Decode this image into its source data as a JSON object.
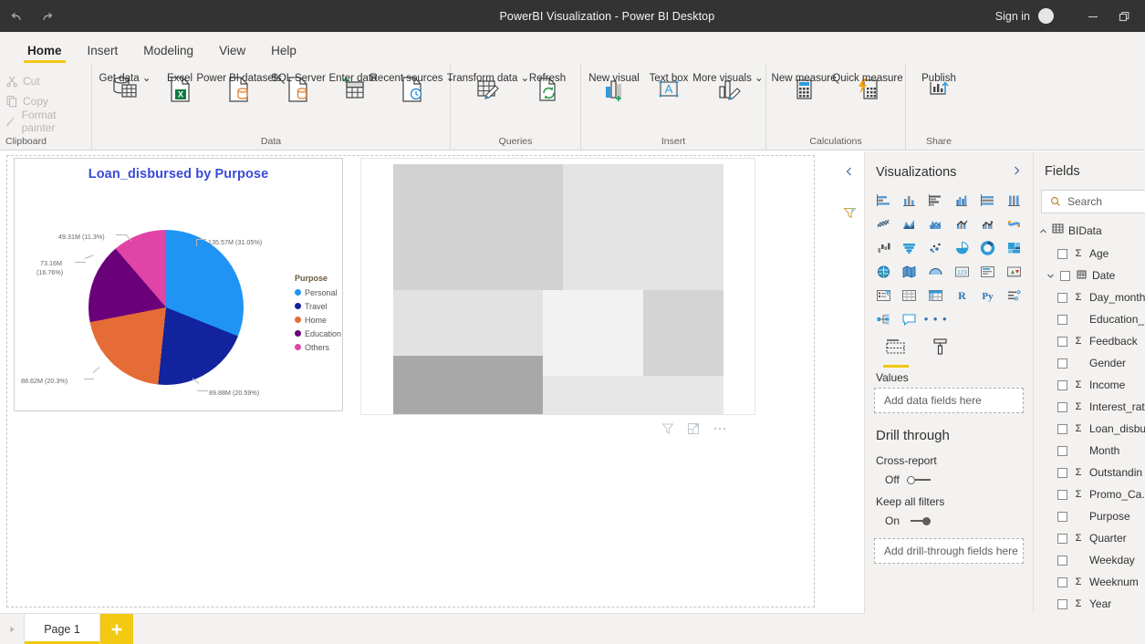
{
  "titlebar": {
    "undo_icon": "undo-icon",
    "redo_icon": "redo-icon",
    "title": "PowerBI Visualization - Power BI Desktop",
    "signin_label": "Sign in",
    "avatar_icon": "account-avatar",
    "minimize_label": "minimize-icon",
    "restore_label": "restore-icon"
  },
  "ribbon": {
    "tabs": [
      {
        "label": "Home",
        "active": true
      },
      {
        "label": "Insert",
        "active": false
      },
      {
        "label": "Modeling",
        "active": false
      },
      {
        "label": "View",
        "active": false
      },
      {
        "label": "Help",
        "active": false
      }
    ],
    "groups": [
      {
        "name": "Clipboard",
        "label": "Clipboard",
        "items": [
          {
            "label": "Cut",
            "icon": "scissors-icon"
          },
          {
            "label": "Copy",
            "icon": "copy-icon"
          },
          {
            "label": "Format painter",
            "icon": "format-painter-icon"
          }
        ]
      },
      {
        "name": "Data",
        "label": "Data",
        "items": [
          {
            "label": "Get data",
            "icon": "get-data-icon",
            "caret": true
          },
          {
            "label": "Excel",
            "icon": "excel-icon",
            "caret": false
          },
          {
            "label": "Power BI datasets",
            "icon": "powerbi-datasets-icon",
            "caret": false
          },
          {
            "label": "SQL Server",
            "icon": "sql-server-icon",
            "caret": false
          },
          {
            "label": "Enter data",
            "icon": "enter-data-icon",
            "caret": false
          },
          {
            "label": "Recent sources",
            "icon": "recent-sources-icon",
            "caret": true
          }
        ]
      },
      {
        "name": "Queries",
        "label": "Queries",
        "items": [
          {
            "label": "Transform data",
            "icon": "transform-data-icon",
            "caret": true
          },
          {
            "label": "Refresh",
            "icon": "refresh-icon",
            "caret": false
          }
        ]
      },
      {
        "name": "Insert",
        "label": "Insert",
        "items": [
          {
            "label": "New visual",
            "icon": "new-visual-icon",
            "caret": false
          },
          {
            "label": "Text box",
            "icon": "text-box-icon",
            "caret": false
          },
          {
            "label": "More visuals",
            "icon": "more-visuals-icon",
            "caret": true
          }
        ]
      },
      {
        "name": "Calculations",
        "label": "Calculations",
        "items": [
          {
            "label": "New measure",
            "icon": "new-measure-icon",
            "caret": false
          },
          {
            "label": "Quick measure",
            "icon": "quick-measure-icon",
            "caret": false
          }
        ]
      },
      {
        "name": "Share",
        "label": "Share",
        "items": [
          {
            "label": "Publish",
            "icon": "publish-icon",
            "caret": false
          }
        ]
      }
    ]
  },
  "chart_data": {
    "type": "pie",
    "title": "Loan_disbursed by Purpose",
    "legend_title": "Purpose",
    "legend_position": "right",
    "categories": [
      "Personal",
      "Travel",
      "Home",
      "Education",
      "Others"
    ],
    "values": [
      135.57,
      89.88,
      88.62,
      73.16,
      49.31
    ],
    "units": "M",
    "percentages": [
      31.05,
      20.59,
      20.3,
      16.76,
      11.3
    ],
    "colors": [
      "#1f94f5",
      "#12239e",
      "#e66c37",
      "#6b007b",
      "#e044a7"
    ],
    "data_labels": [
      "135.57M (31.05%)",
      "89.88M (20.59%)",
      "88.62M (20.3%)",
      "73.16M (16.76%)",
      "49.31M (11.3%)"
    ],
    "title_color": "#3a4ad8"
  },
  "placeholder_visual": {
    "name": "empty-visual-placeholder",
    "filter_icon": "filter-icon",
    "focus_icon": "focus-mode-icon",
    "more_icon": "more-options-icon"
  },
  "filters_pane": {
    "expand_icon": "chevron-left-icon",
    "filter_icon": "filter-icon",
    "label": "Filters"
  },
  "visualizations_pane": {
    "title": "Visualizations",
    "expand_icon": "chevron-right-icon",
    "icons": [
      "stacked-bar-chart",
      "stacked-column-chart",
      "clustered-bar-chart",
      "clustered-column-chart",
      "100-stacked-bar-chart",
      "100-stacked-column-chart",
      "line-chart",
      "area-chart",
      "stacked-area-chart",
      "line-stacked-column-chart",
      "line-clustered-column-chart",
      "ribbon-chart",
      "waterfall-chart",
      "funnel-chart",
      "scatter-chart",
      "pie-chart",
      "donut-chart",
      "treemap",
      "map",
      "filled-map",
      "azure-map",
      "card",
      "multi-row-card",
      "kpi",
      "slicer",
      "table",
      "matrix",
      "r-script-visual",
      "python-visual",
      "key-influencers",
      "decomposition-tree",
      "qa-visual",
      "more-visuals"
    ],
    "tabs": [
      {
        "name": "fields-tab",
        "icon": "fields-well-icon",
        "active": true
      },
      {
        "name": "format-tab",
        "icon": "paint-roller-icon",
        "active": false
      }
    ],
    "well_label": "Values",
    "well_placeholder": "Add data fields here",
    "drill_through": {
      "heading": "Drill through",
      "cross_report_label": "Cross-report",
      "cross_report_state": "Off",
      "keep_filters_label": "Keep all filters",
      "keep_filters_state": "On",
      "drill_placeholder": "Add drill-through fields here"
    }
  },
  "fields_pane": {
    "title": "Fields",
    "search_placeholder": "Search",
    "search_icon": "search-icon",
    "table": {
      "name": "BIData",
      "icon": "table-icon",
      "expanded": true
    },
    "fields": [
      {
        "name": "Age",
        "aggregate": true,
        "expandable": false,
        "icon": ""
      },
      {
        "name": "Date",
        "aggregate": false,
        "expandable": true,
        "icon": "calendar-icon"
      },
      {
        "name": "Day_month",
        "aggregate": true,
        "expandable": false,
        "icon": ""
      },
      {
        "name": "Education_",
        "aggregate": false,
        "expandable": false,
        "icon": ""
      },
      {
        "name": "Feedback",
        "aggregate": true,
        "expandable": false,
        "icon": ""
      },
      {
        "name": "Gender",
        "aggregate": false,
        "expandable": false,
        "icon": ""
      },
      {
        "name": "Income",
        "aggregate": true,
        "expandable": false,
        "icon": ""
      },
      {
        "name": "Interest_rat",
        "aggregate": true,
        "expandable": false,
        "icon": ""
      },
      {
        "name": "Loan_disbu",
        "aggregate": true,
        "expandable": false,
        "icon": ""
      },
      {
        "name": "Month",
        "aggregate": false,
        "expandable": false,
        "icon": ""
      },
      {
        "name": "Outstandin",
        "aggregate": true,
        "expandable": false,
        "icon": ""
      },
      {
        "name": "Promo_Ca.",
        "aggregate": true,
        "expandable": false,
        "icon": ""
      },
      {
        "name": "Purpose",
        "aggregate": false,
        "expandable": false,
        "icon": ""
      },
      {
        "name": "Quarter",
        "aggregate": true,
        "expandable": false,
        "icon": ""
      },
      {
        "name": "Weekday",
        "aggregate": false,
        "expandable": false,
        "icon": ""
      },
      {
        "name": "Weeknum",
        "aggregate": true,
        "expandable": false,
        "icon": ""
      },
      {
        "name": "Year",
        "aggregate": true,
        "expandable": false,
        "icon": ""
      }
    ]
  },
  "page_bar": {
    "nav_icon": "page-next-icon",
    "tabs": [
      {
        "label": "Page 1",
        "active": true
      }
    ],
    "add_label": "+",
    "accent": "#f2c811"
  }
}
